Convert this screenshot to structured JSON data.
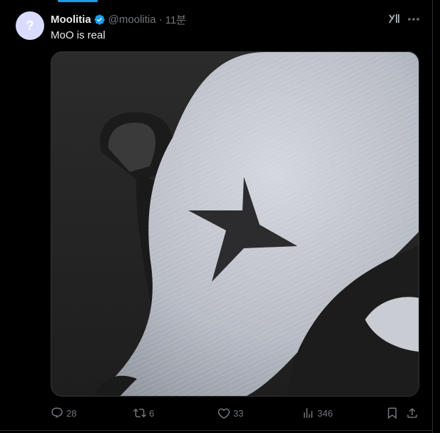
{
  "tweet": {
    "display_name": "Moolitia",
    "handle": "@moolitia",
    "separator": "·",
    "time": "11분",
    "text": "MoO is real",
    "avatar_glyph": "?"
  },
  "actions": {
    "replies": "28",
    "reposts": "6",
    "likes": "33",
    "views": "346"
  },
  "icons": {
    "verified": "verified-badge-icon",
    "grok": "grok-icon",
    "more": "more-dots-icon",
    "reply": "reply-icon",
    "repost": "repost-icon",
    "like": "heart-icon",
    "views": "views-chart-icon",
    "bookmark": "bookmark-icon",
    "share": "share-icon"
  },
  "colors": {
    "background": "#000000",
    "text": "#e7e9ea",
    "muted": "#71767b",
    "accent": "#1d9bf0",
    "border": "#2f3336"
  }
}
